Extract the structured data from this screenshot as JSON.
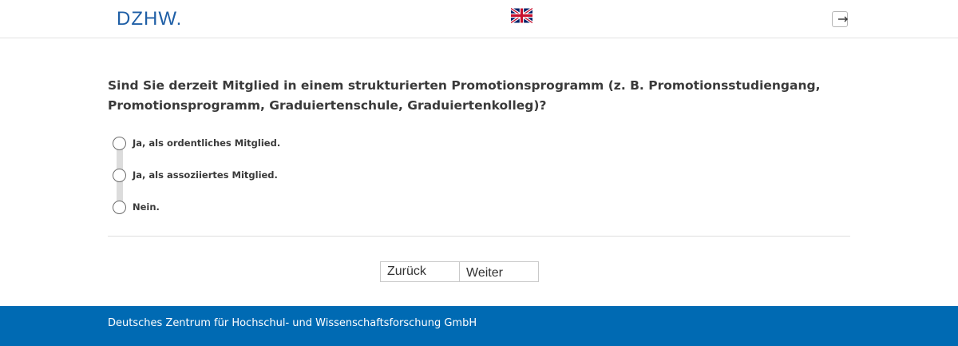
{
  "header": {
    "logo_text": "DZHW.",
    "language_flag_icon": "uk-flag-icon",
    "logout_icon": "logout-icon"
  },
  "question": {
    "text": "Sind Sie derzeit Mitglied in einem strukturierten Promotionsprogramm (z. B. Promotionsstudiengang, Promotionsprogramm, Graduiertenschule, Graduiertenkolleg)?",
    "options": [
      {
        "label": "Ja, als ordentliches Mitglied.",
        "selected": false
      },
      {
        "label": "Ja, als assoziiertes Mitglied.",
        "selected": false
      },
      {
        "label": "Nein.",
        "selected": false
      }
    ]
  },
  "navigation": {
    "back_label": "Zurück",
    "next_label": "Weiter"
  },
  "footer": {
    "text": "Deutsches Zentrum für Hochschul- und Wissenschaftsforschung GmbH"
  },
  "colors": {
    "brand_blue": "#006ab3",
    "logo_blue": "#1f5fa6"
  }
}
